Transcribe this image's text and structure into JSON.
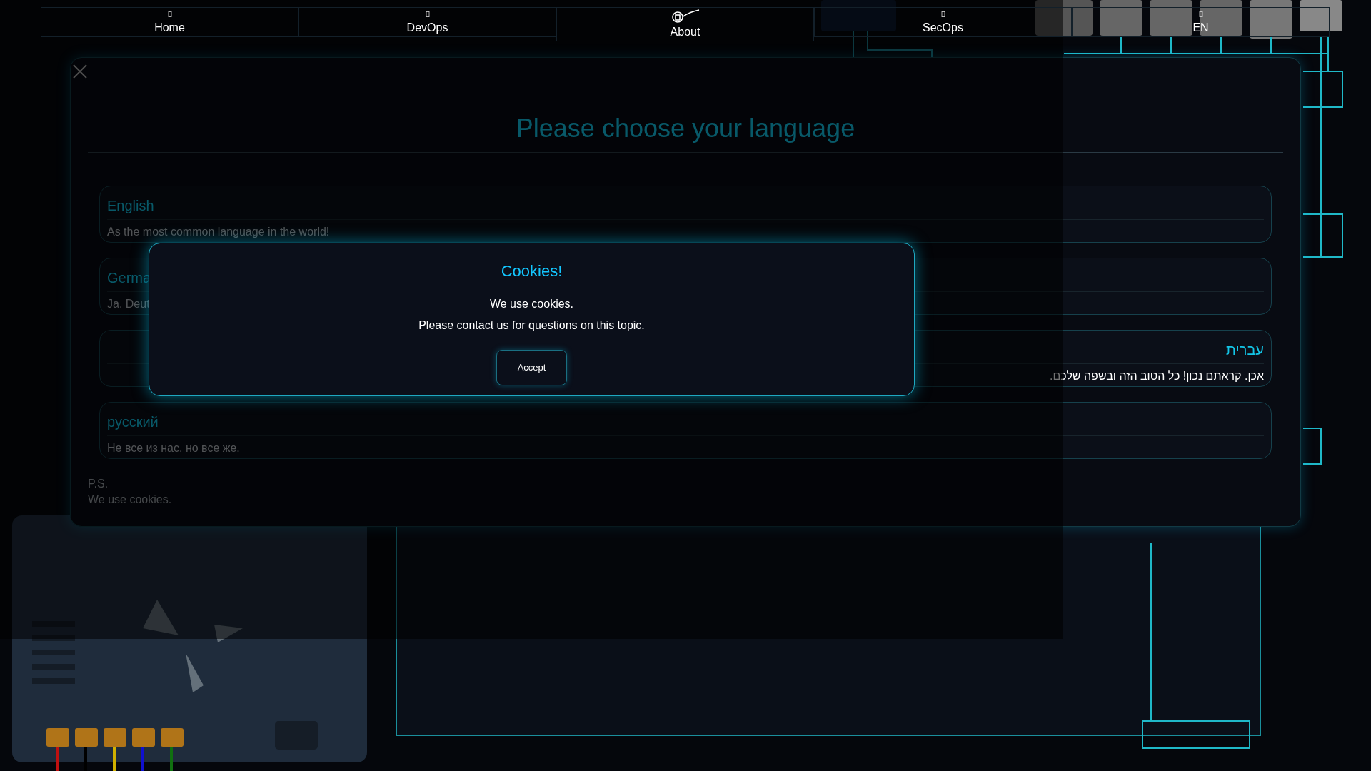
{
  "nav": [
    {
      "label": "Home"
    },
    {
      "label": "DevOps"
    },
    {
      "label": "About"
    },
    {
      "label": "SecOps"
    },
    {
      "label": "EN"
    }
  ],
  "language_dialog": {
    "title": "Please choose your language",
    "languages": [
      {
        "name": "English",
        "description": "As the most common language in the world!",
        "kind": "ltr"
      },
      {
        "name": "Germa",
        "description": "Ja. Deut",
        "kind": "ltr"
      },
      {
        "name": "עברית",
        "description": "אכן. קראתם נכון! כל הטוב הזה ובשפה שלכם.",
        "kind": "rtl"
      },
      {
        "name": "русский",
        "description": "Не все из нас, но все же.",
        "kind": "ltr"
      }
    ],
    "footnote": [
      "P.S.",
      "We use cookies."
    ]
  },
  "cookie_dialog": {
    "title": "Cookies!",
    "lines": [
      "We use cookies.",
      "Please contact us for questions on this topic."
    ],
    "button": "Accept"
  }
}
